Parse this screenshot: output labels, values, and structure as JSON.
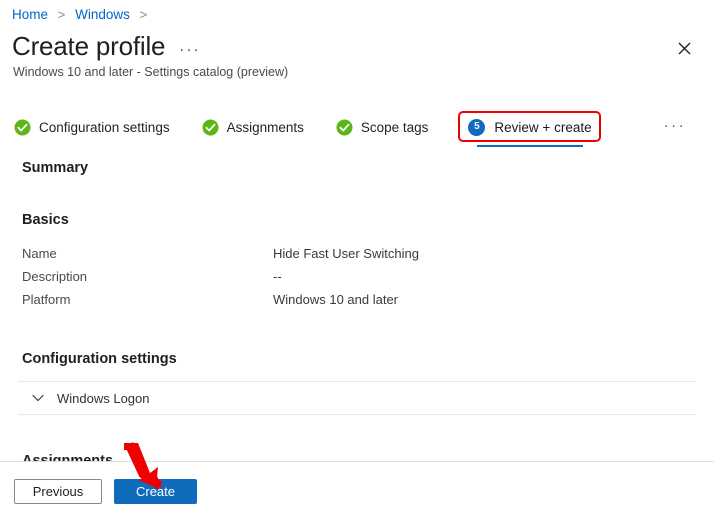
{
  "breadcrumb": {
    "items": [
      {
        "label": "Home",
        "separator": ">"
      },
      {
        "label": "Windows",
        "separator": ">"
      }
    ]
  },
  "header": {
    "title": "Create profile",
    "title_more_icon": "ellipsis-horizontal-icon",
    "subtitle": "Windows 10 and later - Settings catalog (preview)",
    "close_icon": "close-icon"
  },
  "tabs": {
    "items": [
      {
        "label": "Configuration settings",
        "icon": "check-circle-icon",
        "state": "complete",
        "badge": ""
      },
      {
        "label": "Assignments",
        "icon": "check-circle-icon",
        "state": "complete",
        "badge": ""
      },
      {
        "label": "Scope tags",
        "icon": "check-circle-icon",
        "state": "complete",
        "badge": ""
      },
      {
        "label": "Review + create",
        "icon": "step-number-badge",
        "state": "active",
        "badge": "5"
      }
    ],
    "more_icon": "ellipsis-horizontal-icon"
  },
  "main": {
    "summary_heading": "Summary",
    "basics_heading": "Basics",
    "basics_rows": [
      {
        "key": "Name",
        "value": "Hide Fast User Switching"
      },
      {
        "key": "Description",
        "value": "--"
      },
      {
        "key": "Platform",
        "value": "Windows 10 and later"
      }
    ],
    "config_heading": "Configuration settings",
    "config_group": {
      "label": "Windows Logon",
      "chevron_icon": "chevron-down-icon"
    },
    "assignments_heading": "Assignments"
  },
  "footer": {
    "previous_label": "Previous",
    "create_label": "Create"
  },
  "annotations": {
    "highlight_target": "Review + create",
    "arrow_target": "Create",
    "color": "#ee0000"
  },
  "colors": {
    "accent": "#0f6cbd",
    "link": "#0066cc",
    "success": "#5cb617",
    "annotation": "#ee0000"
  }
}
